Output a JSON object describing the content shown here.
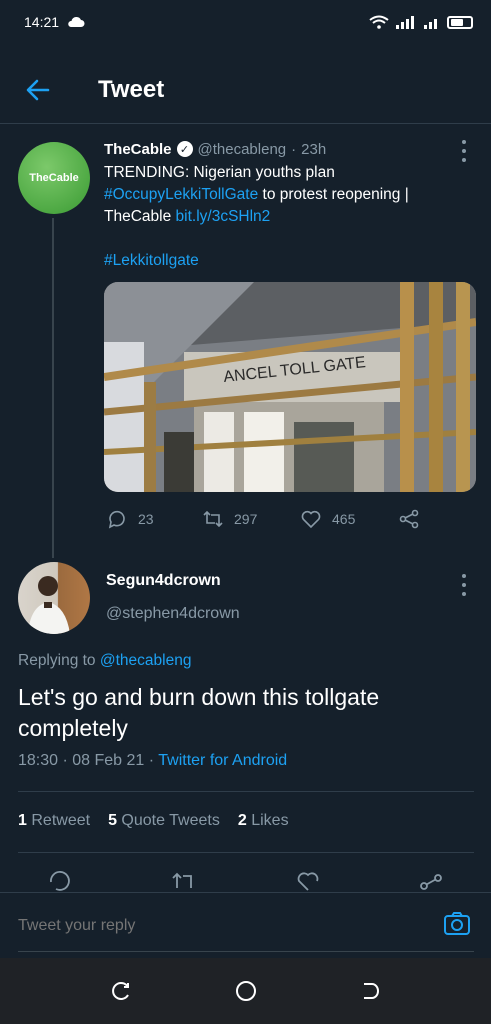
{
  "status_bar": {
    "time": "14:21",
    "cloud_icon": "cloud-icon",
    "wifi_icon": "wifi-icon",
    "signal_icon": "signal-icon",
    "battery_icon": "battery-icon"
  },
  "header": {
    "back_icon": "arrow-left-icon",
    "title": "Tweet"
  },
  "quoted_tweet": {
    "avatar_text": "TheCable",
    "author_name": "TheCable",
    "handle": "@thecableng",
    "separator": "·",
    "time": "23h",
    "text_line1": "TRENDING: Nigerian youths plan",
    "hashtag1": "#OccupyLekkiTollGate",
    "text_line2_rest": " to protest reopening |",
    "text_line3": "TheCable ",
    "link": "bit.ly/3cSHln2",
    "hashtag2": "#Lekkitollgate",
    "image_text": "ANCEL TOLL GATE",
    "replies": "23",
    "retweets": "297",
    "likes": "465"
  },
  "reply_tweet": {
    "author_name": "Segun4dcrown",
    "handle": "@stephen4dcrown",
    "replying_prefix": "Replying to ",
    "replying_to": "@thecableng",
    "text": "Let's go and burn down this tollgate completely",
    "timestamp": "18:30 · 08 Feb 21 · ",
    "source": "Twitter for Android"
  },
  "stats": {
    "retweets_count": "1",
    "retweets_label": "Retweet",
    "quotes_count": "5",
    "quotes_label": "Quote Tweets",
    "likes_count": "2",
    "likes_label": "Likes"
  },
  "reply_bar": {
    "placeholder": "Tweet your reply",
    "camera_icon": "camera-icon"
  },
  "colors": {
    "background": "#15202b",
    "accent": "#1da1f2",
    "muted": "#8899a6",
    "divider": "#2f3d4a",
    "cable_green": "#3a9b33"
  }
}
